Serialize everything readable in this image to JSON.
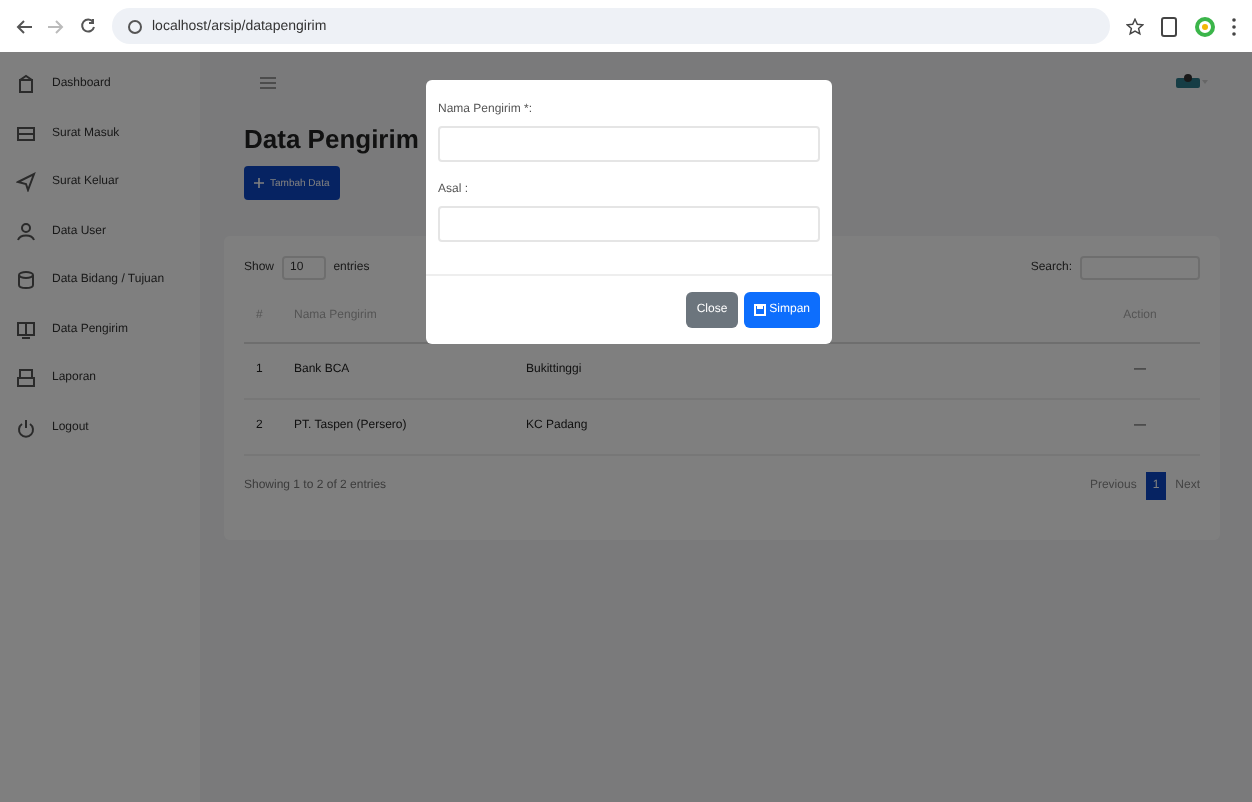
{
  "browser": {
    "url": "localhost/arsip/datapengirim"
  },
  "sidebar": {
    "items": [
      {
        "label": "Dashboard"
      },
      {
        "label": "Surat Masuk"
      },
      {
        "label": "Surat Keluar"
      },
      {
        "label": "Data User"
      },
      {
        "label": "Data Bidang / Tujuan"
      },
      {
        "label": "Data Pengirim"
      },
      {
        "label": "Laporan"
      },
      {
        "label": "Logout"
      }
    ]
  },
  "main": {
    "page_title": "Data Pengirim",
    "add_button": "Tambah Data",
    "table": {
      "show_label": "Show",
      "page_length": "10",
      "entries_label": "entries",
      "search_label": "Search:",
      "columns": [
        {
          "label": "#"
        },
        {
          "label": "Nama Pengirim"
        },
        {},
        {
          "label": "Action"
        }
      ],
      "rows": [
        {
          "cells": [
            "1",
            "Bank BCA",
            "Bukittinggi",
            "—"
          ]
        },
        {
          "cells": [
            "2",
            "PT. Taspen (Persero)",
            "KC Padang",
            "—"
          ]
        }
      ],
      "info": "Showing 1 to 2 of 2 entries",
      "pagination": {
        "previous": "Previous",
        "pages": [
          {
            "label": "1",
            "selected": true
          }
        ],
        "next": "Next"
      }
    }
  },
  "modal": {
    "fields": [
      {
        "label": "Nama Pengirim *:"
      },
      {
        "label": "Asal :"
      }
    ],
    "close_button": "Close",
    "save_button": "Simpan"
  }
}
